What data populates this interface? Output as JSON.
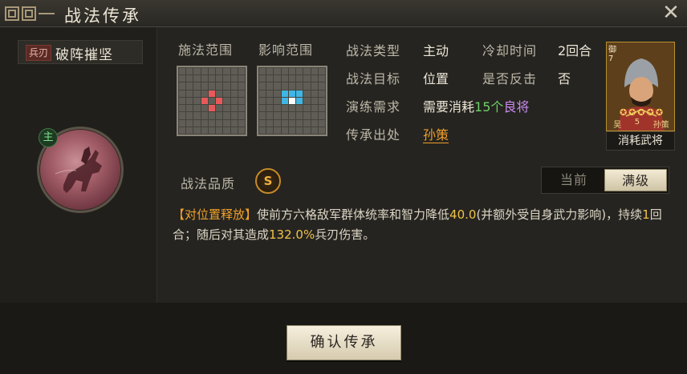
{
  "title": "战法传承",
  "icons": {
    "close": "close-icon",
    "ornament": "title-ornament-icon"
  },
  "skill": {
    "troop_tag": "兵刃",
    "name": "破阵摧坚",
    "main_badge": "主"
  },
  "ranges": {
    "cast_label": "施法范围",
    "effect_label": "影响范围"
  },
  "attrs": {
    "type_label": "战法类型",
    "type_value": "主动",
    "cooldown_label": "冷却时间",
    "cooldown_value": "2回合",
    "target_label": "战法目标",
    "target_value": "位置",
    "counter_label": "是否反击",
    "counter_value": "否",
    "train_label": "演练需求",
    "train_pre": "需要消耗",
    "train_count": "15个",
    "train_item": "良将",
    "source_label": "传承出处",
    "source_value": "孙策"
  },
  "general_card": {
    "side_text": "御7",
    "faction": "吴",
    "cost": "5",
    "name": "孙策",
    "stars": 5,
    "caption": "消耗武将"
  },
  "quality": {
    "label": "战法品质",
    "grade": "S"
  },
  "toggle": {
    "current": "当前",
    "max": "满级",
    "active": "max"
  },
  "description": {
    "kw": "【对位置释放】",
    "p1": "使前方六格敌军群体统率和智力降低",
    "n1": "40.0",
    "p2": "(并额外受自身武力影响)，持续",
    "n2": "1",
    "p3": "回合；随后对其造成",
    "n3": "132.0%",
    "p4": "兵刃伤害。"
  },
  "confirm_button": "确认传承",
  "colors": {
    "accent": "#f0a02a",
    "cast": "#e85a5a",
    "effect": "#3fb6e4",
    "highlight": "#6fd06a",
    "purple": "#c98aef"
  }
}
